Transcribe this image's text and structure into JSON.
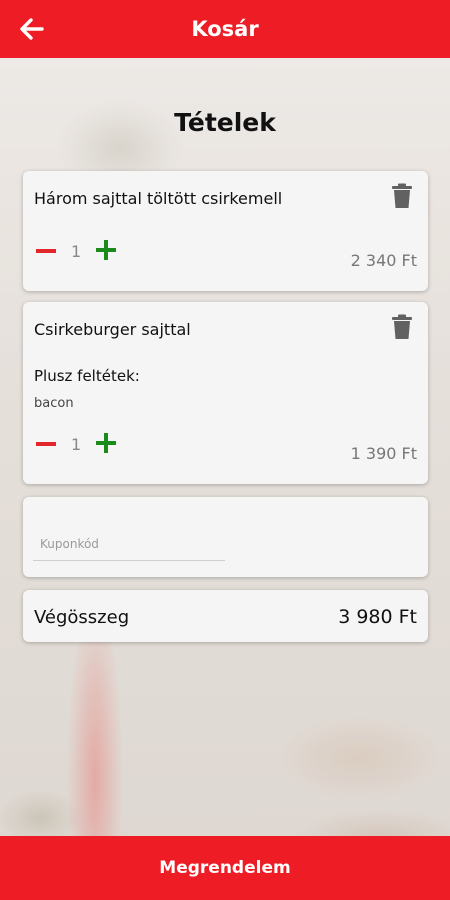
{
  "header": {
    "title": "Kosár",
    "back_icon": "arrow-left-icon"
  },
  "section": {
    "title": "Tételek"
  },
  "items": [
    {
      "name": "Három sajttal töltött csirkemell",
      "quantity": "1",
      "price": "2 340 Ft"
    },
    {
      "name": "Csirkeburger sajttal",
      "extras_label": "Plusz feltétek:",
      "extras": "bacon",
      "quantity": "1",
      "price": "1 390 Ft"
    }
  ],
  "coupon": {
    "placeholder": "Kuponkód",
    "value": ""
  },
  "total": {
    "label": "Végösszeg",
    "value": "3 980 Ft"
  },
  "footer": {
    "order_label": "Megrendelem"
  },
  "colors": {
    "brand_red": "#ee1c25",
    "minus_red": "#e3262b",
    "plus_green": "#1b8a1b",
    "trash_gray": "#616161"
  }
}
